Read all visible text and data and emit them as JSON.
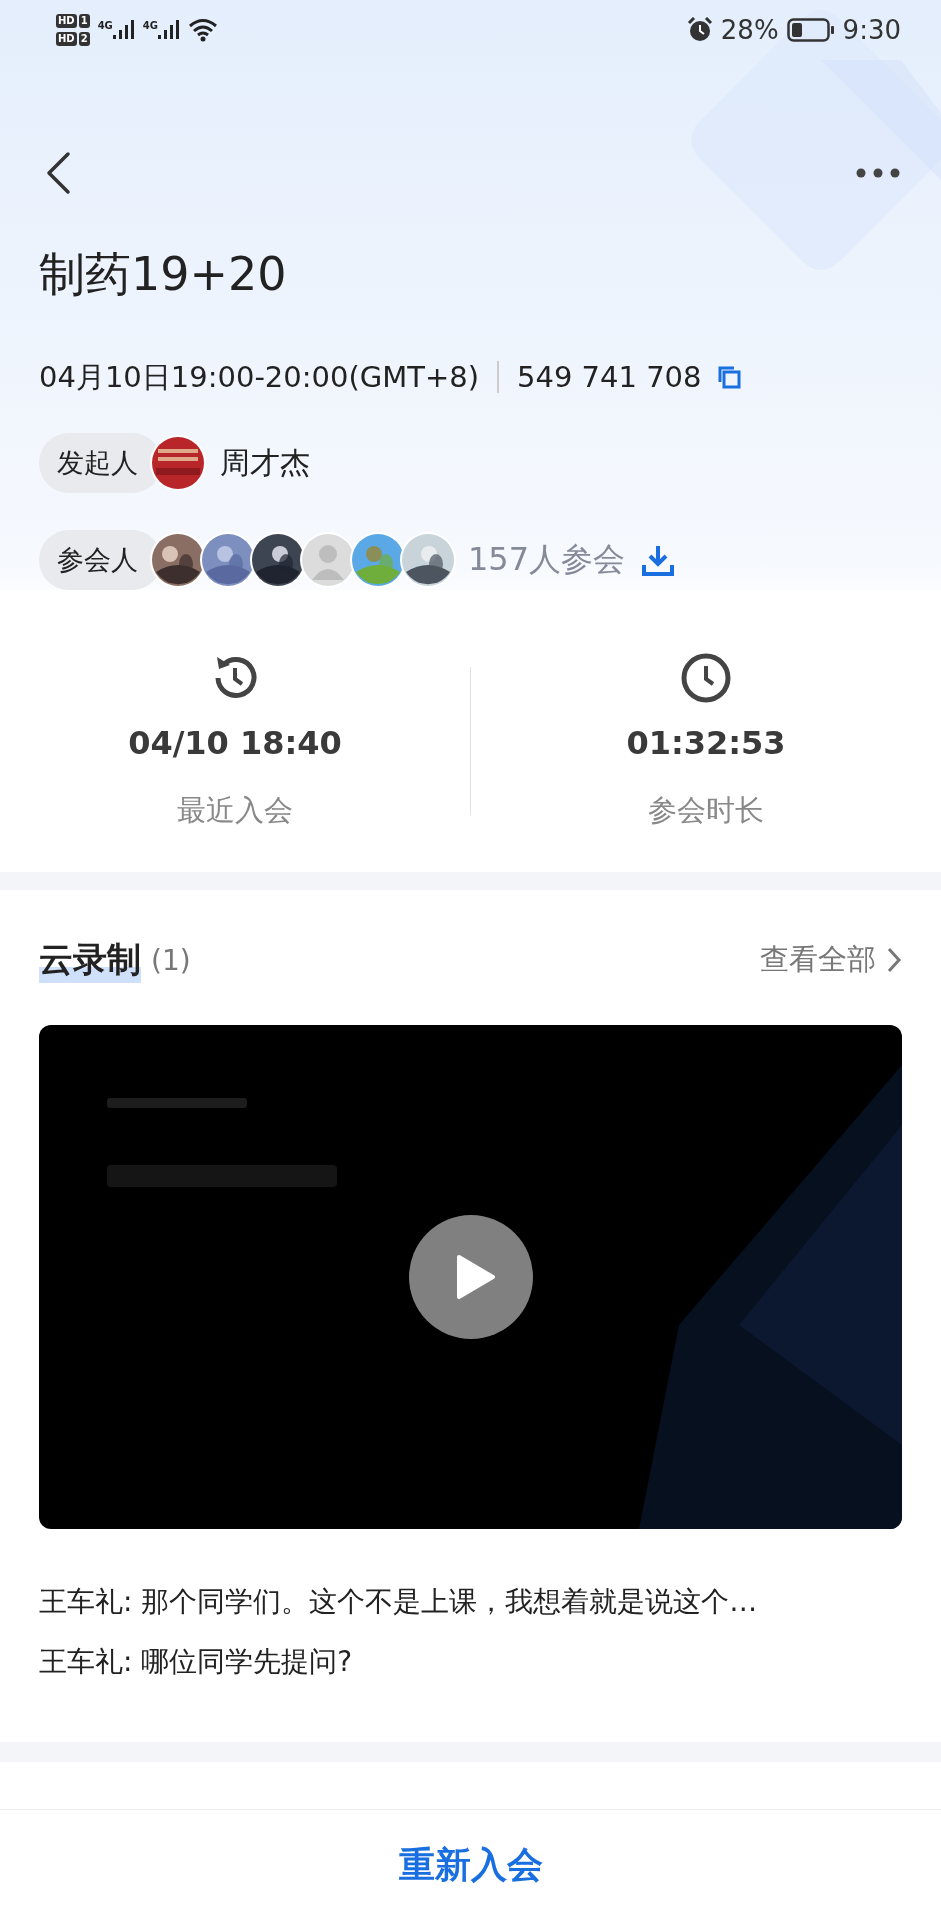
{
  "status_bar": {
    "sims": [
      {
        "label": "HD",
        "slot": "1"
      },
      {
        "label": "HD",
        "slot": "2"
      }
    ],
    "networks": [
      "4G",
      "4G"
    ],
    "battery": "28%",
    "time": "9:30"
  },
  "meeting": {
    "title": "制药19+20",
    "time": "04月10日19:00-20:00(GMT+8)",
    "meeting_id": "549 741 708"
  },
  "host": {
    "label": "发起人",
    "avatar": {
      "kind": "picture"
    },
    "name": "周才杰"
  },
  "participants": {
    "label": "参会人",
    "avatars": [
      {
        "kind": "picture"
      },
      {
        "kind": "picture"
      },
      {
        "kind": "picture"
      },
      {
        "kind": "default"
      },
      {
        "kind": "picture"
      },
      {
        "kind": "picture"
      }
    ],
    "count": "157人参会"
  },
  "stats": [
    {
      "kind": "history",
      "value": "04/10 18:40",
      "label": "最近入会"
    },
    {
      "kind": "clock",
      "value": "01:32:53",
      "label": "参会时长"
    }
  ],
  "recording": {
    "title": "云录制",
    "count": "(1)",
    "view_all": "查看全部",
    "video": {
      "kind": "picture"
    },
    "transcript": [
      {
        "speaker": "王车礼:",
        "text": "那个同学们。这个不是上课，我想着就是说这个…"
      },
      {
        "speaker": "王车礼:",
        "text": "哪位同学先提问?"
      }
    ]
  },
  "rejoin_button": "重新入会"
}
